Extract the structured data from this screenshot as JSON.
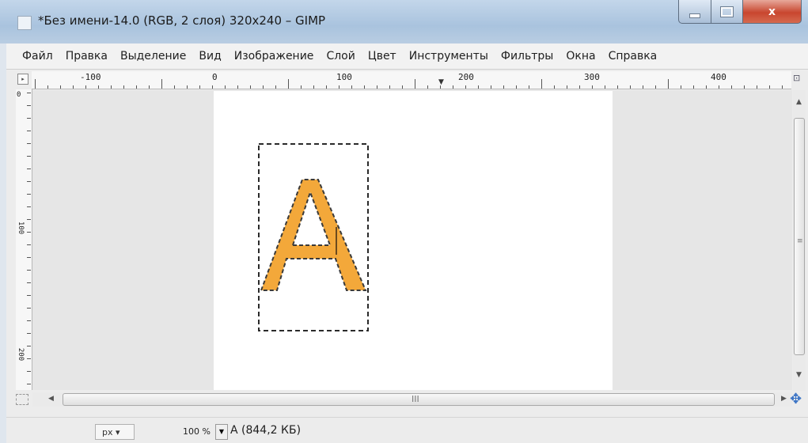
{
  "window": {
    "title": "*Без имени-14.0 (RGB, 2 слоя) 320x240 – GIMP",
    "close_glyph": "x"
  },
  "menu": [
    "Файл",
    "Правка",
    "Выделение",
    "Вид",
    "Изображение",
    "Слой",
    "Цвет",
    "Инструменты",
    "Фильтры",
    "Окна",
    "Справка"
  ],
  "ruler": {
    "top_labels": [
      "-100",
      "0",
      "100",
      "200",
      "300",
      "400"
    ],
    "left_labels": [
      "0",
      "100",
      "200"
    ]
  },
  "canvas": {
    "letter": "A",
    "letter_color": "#f3a83a",
    "outline_color": "#3a3a3a",
    "image_bg": "#ffffff",
    "hscroll_grip": "III",
    "vscroll_grip": "≡"
  },
  "status": {
    "unit": "px",
    "zoom": "100 %",
    "info": "A (844,2 КБ)"
  }
}
